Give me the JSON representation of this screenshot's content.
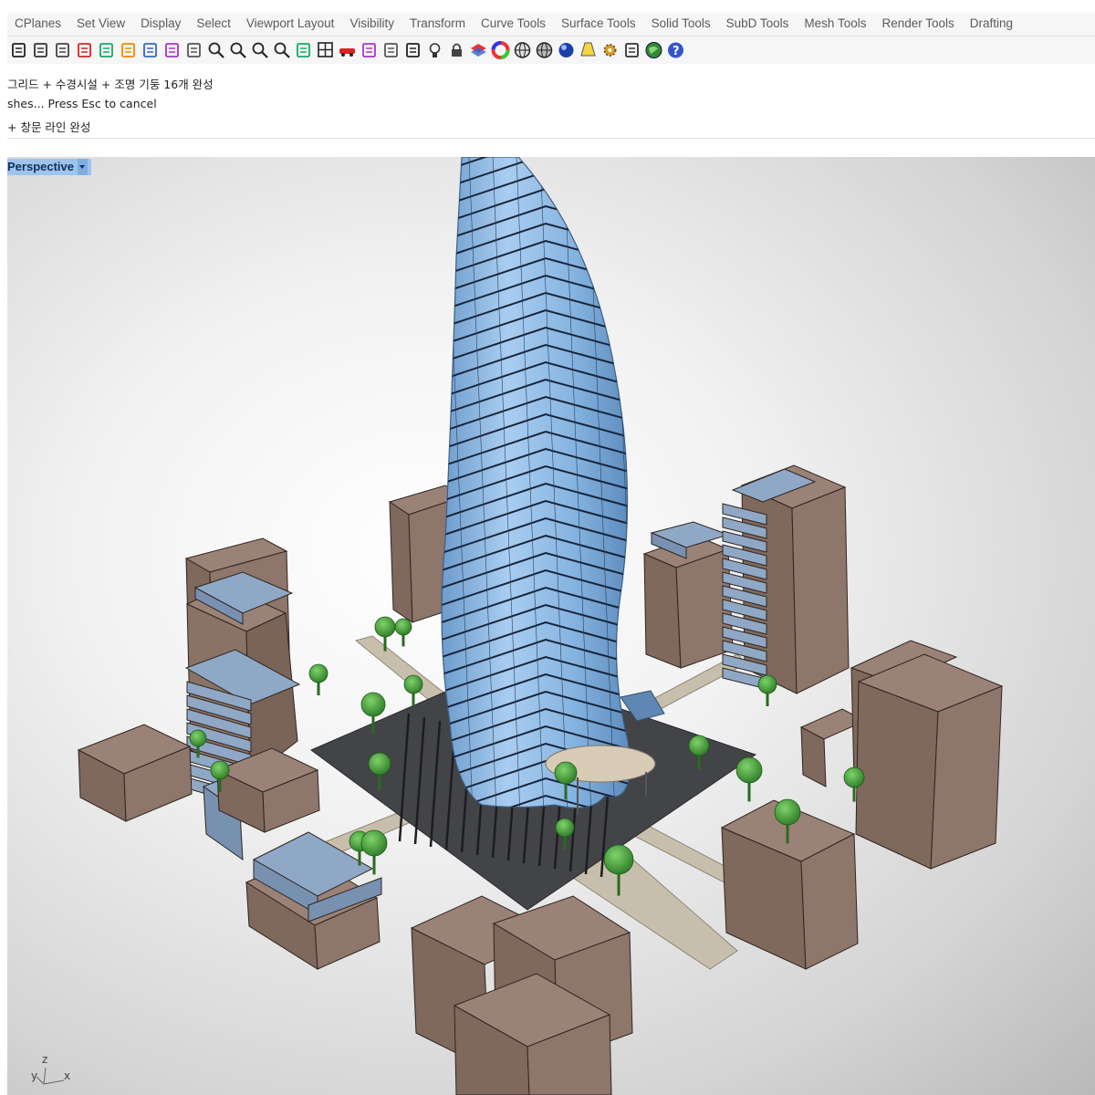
{
  "menu_tabs": [
    "CPlanes",
    "Set View",
    "Display",
    "Select",
    "Viewport Layout",
    "Visibility",
    "Transform",
    "Curve Tools",
    "Surface Tools",
    "Solid Tools",
    "SubD Tools",
    "Mesh Tools",
    "Render Tools",
    "Drafting"
  ],
  "toolbar_icons": [
    "save-icon",
    "print-icon",
    "import-icon",
    "cut-icon",
    "copy-icon",
    "paste-icon",
    "undo-icon",
    "pan-hand-icon",
    "rotate-view-icon",
    "zoom-icon",
    "zoom-window-icon",
    "zoom-extents-icon",
    "zoom-selected-icon",
    "undo-view-icon",
    "four-viewports-icon",
    "car-named-view-icon",
    "cplane-icon",
    "grid-snap-icon",
    "points-on-icon",
    "light-bulb-icon",
    "lock-icon",
    "layer-icon",
    "color-wheel-icon",
    "sphere-shade-icon",
    "wireframe-sphere-icon",
    "render-sphere-icon",
    "spotlight-icon",
    "options-gear-icon",
    "dimension-icon",
    "globe-icon",
    "help-icon"
  ],
  "command_history": {
    "line1": " 그리드 + 수경시설 + 조명 기둥 16개 완성",
    "line2": "shes... Press Esc to cancel",
    "line3": "+ 창문 라인 완성"
  },
  "viewport": {
    "name": "Perspective",
    "axis": {
      "x": "x",
      "y": "y",
      "z": "z"
    }
  },
  "colors": {
    "building_brown": "#8c7468",
    "glass_blue": "#8ea9c9",
    "tower_blue": "#86b1dc",
    "plaza": "#3e3f41",
    "tree_green": "#3d8f35",
    "path": "#c0b7a2"
  }
}
